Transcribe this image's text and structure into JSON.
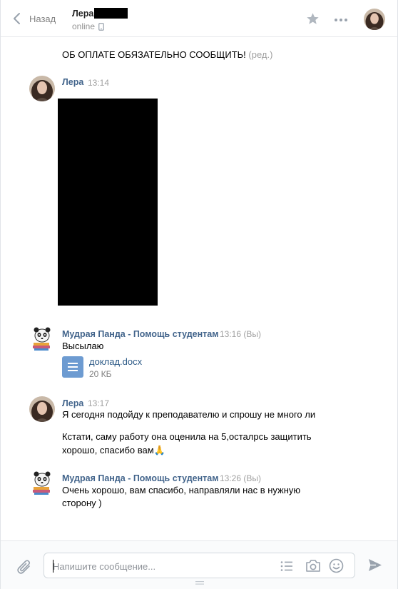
{
  "header": {
    "back_label": "Назад",
    "peer_name": "Лера",
    "peer_status": "online"
  },
  "messages": [
    {
      "kind": "continuation",
      "text": "ОБ ОПЛАТЕ ОБЯЗАТЕЛЬНО СООБЩИТЬ!",
      "edited_label": "(ред.)"
    },
    {
      "kind": "group",
      "author": "Лера",
      "time": "13:14",
      "attachment": "photo-redacted"
    },
    {
      "kind": "group",
      "author": "Мудрая Панда - Помощь студентам",
      "time": "13:16",
      "suffix": "(Вы)",
      "text": "Высылаю",
      "document": {
        "title": "доклад.docx",
        "size": "20 КБ"
      }
    },
    {
      "kind": "group",
      "author": "Лера",
      "time": "13:17",
      "lines": [
        "Я сегодня подойду к преподавателю и спрошу не много ли",
        "Кстати, саму работу она оценила на 5,осталрсь защитить",
        "хорошо, спасибо вам🙏"
      ]
    },
    {
      "kind": "group",
      "author": "Мудрая Панда - Помощь студентам",
      "time": "13:26",
      "suffix": "(Вы)",
      "lines": [
        "Очень хорошо, вам спасибо, направляли нас в нужную",
        "сторону )"
      ]
    }
  ],
  "composer": {
    "placeholder": "Напишите сообщение..."
  },
  "icons": [
    "chevron-left-icon",
    "phone-icon",
    "star-icon",
    "more-icon",
    "paperclip-icon",
    "list-icon",
    "camera-icon",
    "smile-icon",
    "send-icon"
  ],
  "colors": {
    "link": "#42648b",
    "doc_link": "#2a5885",
    "muted": "#a0a0a0",
    "doc_icon": "#6d9bd1",
    "border": "#e7e8ec"
  }
}
